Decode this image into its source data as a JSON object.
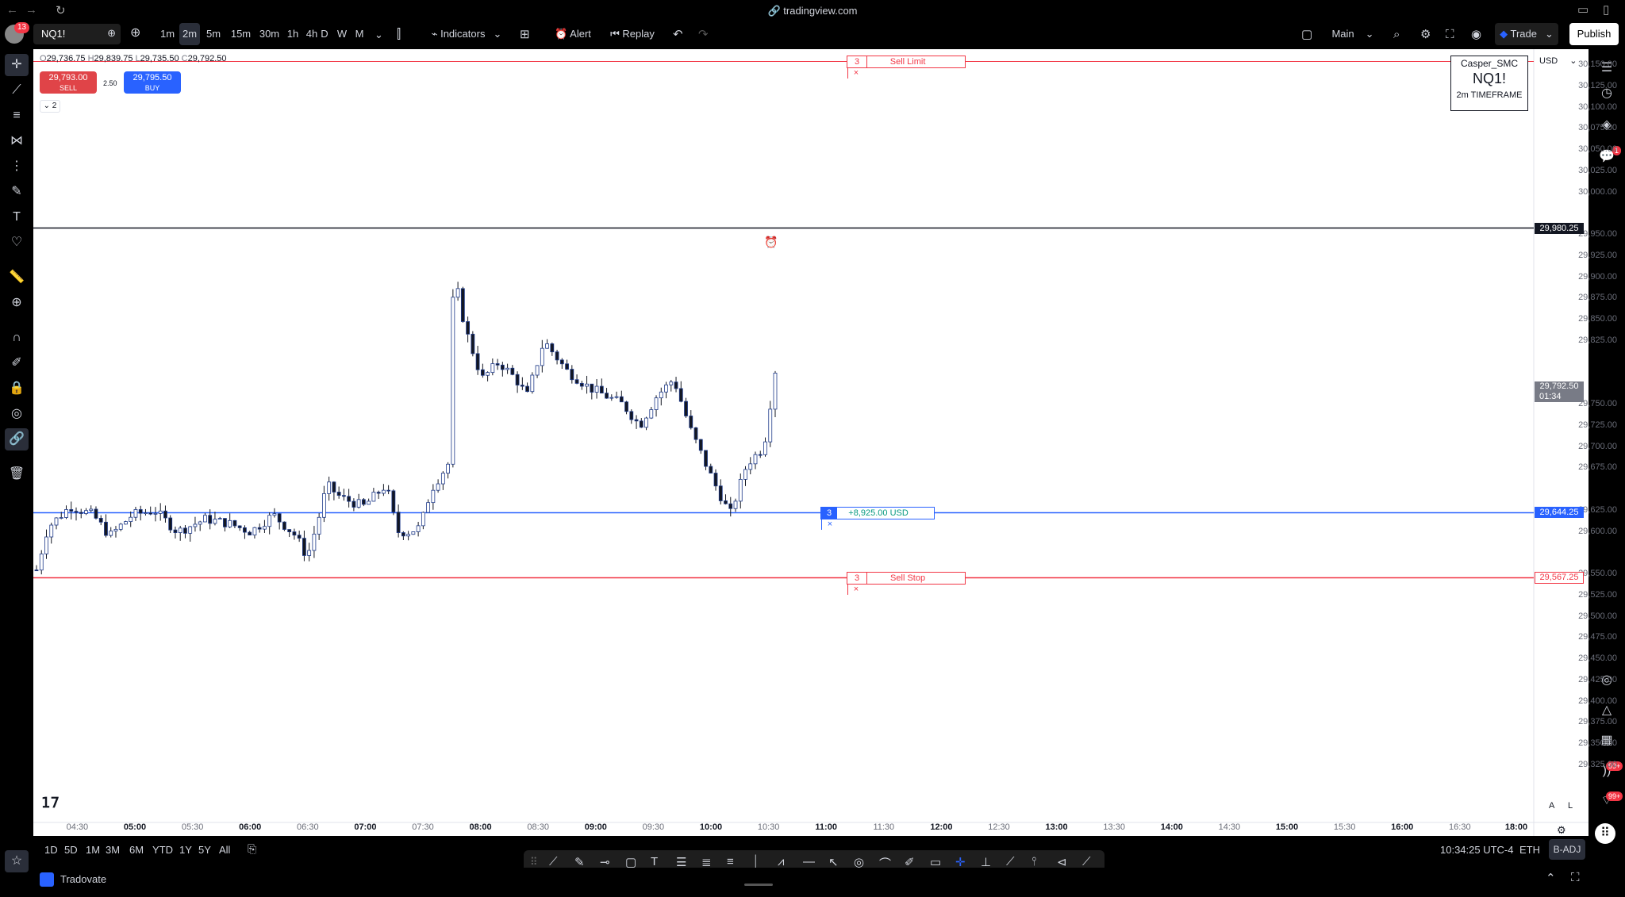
{
  "browser": {
    "url": "tradingview.com",
    "notifications": "13"
  },
  "toolbar": {
    "symbol": "NQ1!",
    "intervals": [
      "1m",
      "2m",
      "5m",
      "15m",
      "30m",
      "1h",
      "4h",
      "D",
      "W",
      "M"
    ],
    "active_interval": "2m",
    "indicators_label": "Indicators",
    "alert_label": "Alert",
    "replay_label": "Replay",
    "layout_label": "Main",
    "trade_label": "Trade",
    "publish_label": "Publish"
  },
  "legend": {
    "ohlc": [
      {
        "key": "O",
        "value": "29,736.75"
      },
      {
        "key": "H",
        "value": "29,839.75"
      },
      {
        "key": "L",
        "value": "29,735.50"
      },
      {
        "key": "C",
        "value": "29,792.50"
      }
    ],
    "sell_price": "29,793.00",
    "sell_label": "SELL",
    "spread": "2.50",
    "buy_price": "29,795.50",
    "buy_label": "BUY",
    "collapsed_count": "2"
  },
  "watermark": {
    "author": "Casper_SMC",
    "symbol": "NQ1!",
    "timeframe": "2m TIMEFRAME"
  },
  "currency": "USD",
  "price_axis": [
    "30,150.00",
    "30,125.00",
    "30,100.00",
    "30,075.00",
    "30,050.00",
    "30,025.00",
    "30,000.00",
    "29,950.00",
    "29,925.00",
    "29,900.00",
    "29,875.00",
    "29,850.00",
    "29,825.00",
    "29,750.00",
    "29,725.00",
    "29,700.00",
    "29,675.00",
    "29,625.00",
    "29,600.00",
    "29,550.00",
    "29,525.00",
    "29,500.00",
    "29,475.00",
    "29,450.00",
    "29,425.00",
    "29,400.00",
    "29,375.00",
    "29,350.00",
    "29,325.00"
  ],
  "price_tags": {
    "alert_line": "29,980.25",
    "last_price": "29,792.50",
    "countdown": "01:34",
    "position": "29,644.25",
    "stop": "29,567.25"
  },
  "orders": {
    "sell_limit": {
      "qty": "3",
      "label": "Sell Limit"
    },
    "position": {
      "qty": "3",
      "label": "+8,925.00 USD"
    },
    "sell_stop": {
      "qty": "3",
      "label": "Sell Stop"
    }
  },
  "time_axis": [
    {
      "label": "04:30",
      "major": false
    },
    {
      "label": "05:00",
      "major": true
    },
    {
      "label": "05:30",
      "major": false
    },
    {
      "label": "06:00",
      "major": true
    },
    {
      "label": "06:30",
      "major": false
    },
    {
      "label": "07:00",
      "major": true
    },
    {
      "label": "07:30",
      "major": false
    },
    {
      "label": "08:00",
      "major": true
    },
    {
      "label": "08:30",
      "major": false
    },
    {
      "label": "09:00",
      "major": true
    },
    {
      "label": "09:30",
      "major": false
    },
    {
      "label": "10:00",
      "major": true
    },
    {
      "label": "10:30",
      "major": false
    },
    {
      "label": "11:00",
      "major": true
    },
    {
      "label": "11:30",
      "major": false
    },
    {
      "label": "12:00",
      "major": true
    },
    {
      "label": "12:30",
      "major": false
    },
    {
      "label": "13:00",
      "major": true
    },
    {
      "label": "13:30",
      "major": false
    },
    {
      "label": "14:00",
      "major": true
    },
    {
      "label": "14:30",
      "major": false
    },
    {
      "label": "15:00",
      "major": true
    },
    {
      "label": "15:30",
      "major": false
    },
    {
      "label": "16:00",
      "major": true
    },
    {
      "label": "16:30",
      "major": false
    },
    {
      "label": "18:00",
      "major": true
    }
  ],
  "ranges": [
    "1D",
    "5D",
    "1M",
    "3M",
    "6M",
    "YTD",
    "1Y",
    "5Y",
    "All"
  ],
  "status": {
    "clock": "10:34:25 UTC-4",
    "session": "ETH",
    "adj": "B-ADJ"
  },
  "scale_buttons": [
    "A",
    "L"
  ],
  "broker": {
    "name": "Tradovate"
  },
  "right_badges": [
    "1",
    "99+",
    "99+"
  ],
  "colors": {
    "up": "#ffffff",
    "down": "#131722",
    "body_border": "#1e3a8a",
    "position_line": "#2962ff",
    "order_line": "#f23645"
  }
}
